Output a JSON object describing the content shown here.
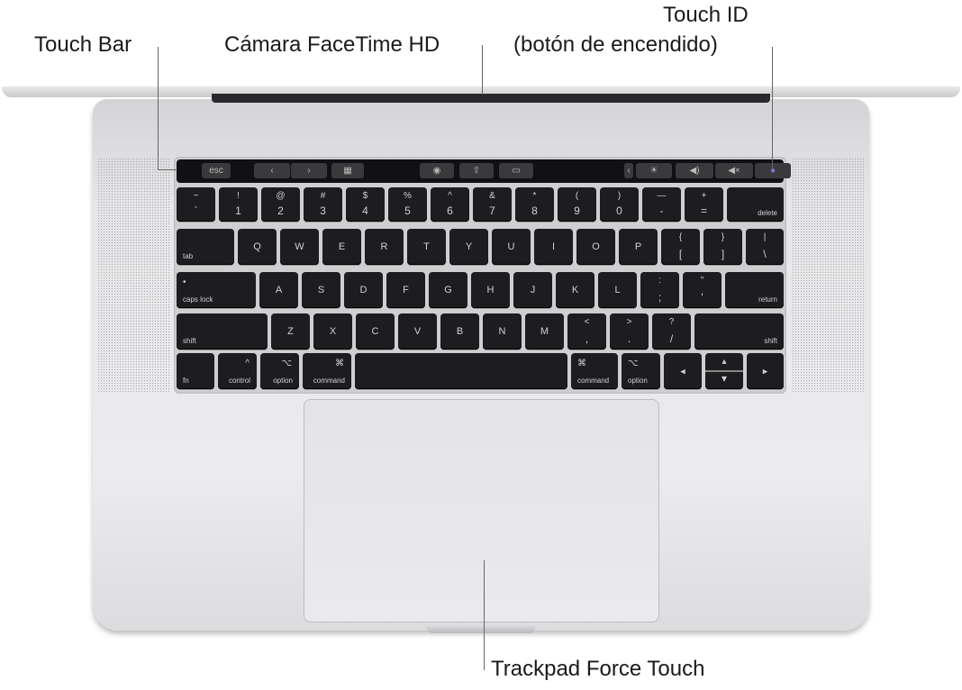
{
  "callouts": {
    "touch_bar": "Touch Bar",
    "camera": "Cámara FaceTime HD",
    "touch_id_line1": "Touch ID",
    "touch_id_line2": "(botón de encendido)",
    "trackpad": "Trackpad Force Touch"
  },
  "touch_bar_buttons": [
    {
      "name": "esc-button",
      "label": "esc"
    },
    {
      "name": "back-icon",
      "label": "‹"
    },
    {
      "name": "forward-icon",
      "label": "›"
    },
    {
      "name": "grid-icon",
      "label": "▦"
    },
    {
      "name": "eye-icon",
      "label": "◉"
    },
    {
      "name": "share-icon",
      "label": "⇧"
    },
    {
      "name": "tag-icon",
      "label": "▭"
    },
    {
      "name": "collapse-icon",
      "label": "‹"
    },
    {
      "name": "brightness-icon",
      "label": "☀"
    },
    {
      "name": "volume-icon",
      "label": "◀)"
    },
    {
      "name": "mute-icon",
      "label": "◀×"
    },
    {
      "name": "siri-icon",
      "label": "●"
    }
  ],
  "keyboard": {
    "row1": [
      [
        "~",
        "`"
      ],
      [
        "!",
        "1"
      ],
      [
        "@",
        "2"
      ],
      [
        "#",
        "3"
      ],
      [
        "$",
        "4"
      ],
      [
        "%",
        "5"
      ],
      [
        "^",
        "6"
      ],
      [
        "&",
        "7"
      ],
      [
        "*",
        "8"
      ],
      [
        "(",
        "9"
      ],
      [
        ")",
        "0"
      ],
      [
        "—",
        "-"
      ],
      [
        "+",
        "="
      ],
      [
        "",
        "delete"
      ]
    ],
    "row2": [
      "tab",
      "Q",
      "W",
      "E",
      "R",
      "T",
      "Y",
      "U",
      "I",
      "O",
      "P",
      [
        "{",
        "["
      ],
      [
        "}",
        "]"
      ],
      [
        "|",
        "\\"
      ]
    ],
    "row3": [
      "caps lock",
      "A",
      "S",
      "D",
      "F",
      "G",
      "H",
      "J",
      "K",
      "L",
      [
        ":",
        ";"
      ],
      [
        "\"",
        "'"
      ],
      "return"
    ],
    "row4": [
      "shift",
      "Z",
      "X",
      "C",
      "V",
      "B",
      "N",
      "M",
      [
        "<",
        ","
      ],
      [
        ">",
        "."
      ],
      [
        "?",
        "/"
      ],
      "shift"
    ],
    "row5": [
      [
        "",
        "fn"
      ],
      [
        "^",
        "control"
      ],
      [
        "⌥",
        "option"
      ],
      [
        "⌘",
        "command"
      ],
      [
        "",
        ""
      ],
      [
        "⌘",
        "command"
      ],
      [
        "⌥",
        "option"
      ],
      [
        "◂",
        ""
      ],
      [
        "▴",
        "▾"
      ],
      [
        "▸",
        ""
      ]
    ]
  },
  "colors": {
    "key": "#1d1d1f",
    "body": "#e6e6e8",
    "touch_bar": "#111113"
  }
}
